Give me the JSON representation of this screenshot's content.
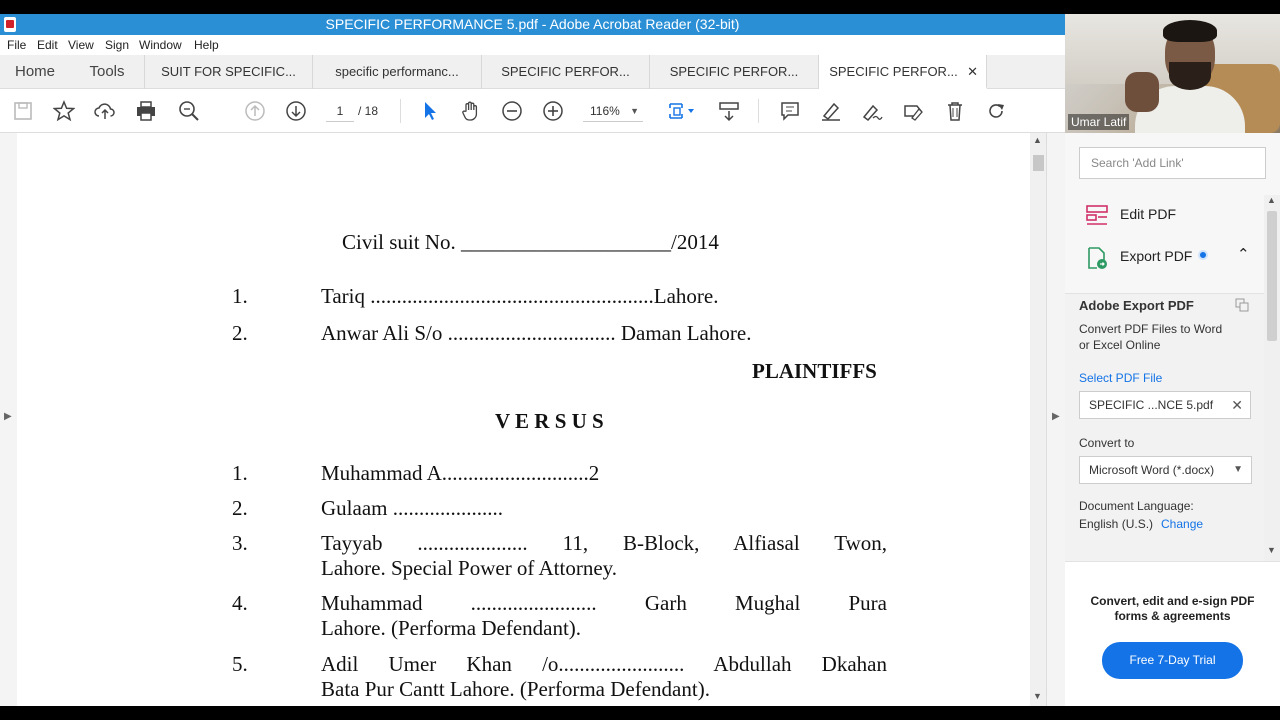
{
  "window": {
    "title": "SPECIFIC PERFORMANCE 5.pdf - Adobe Acrobat Reader (32-bit)"
  },
  "menu": [
    "File",
    "Edit",
    "View",
    "Sign",
    "Window",
    "Help"
  ],
  "nav": {
    "home": "Home",
    "tools": "Tools"
  },
  "tabs": [
    {
      "label": "SUIT FOR SPECIFIC..."
    },
    {
      "label": "specific performanc..."
    },
    {
      "label": "SPECIFIC PERFOR..."
    },
    {
      "label": "SPECIFIC PERFOR..."
    },
    {
      "label": "SPECIFIC PERFOR...",
      "active": true
    }
  ],
  "toolbar": {
    "page_current": "1",
    "page_total": "/ 18",
    "zoom": "116%",
    "icons": [
      "save-icon",
      "bookmark-star-icon",
      "upload-cloud-icon",
      "print-icon",
      "search-zoom-icon",
      "page-up-icon",
      "page-down-icon",
      "select-cursor-icon",
      "hand-icon",
      "zoom-out-icon",
      "zoom-in-icon",
      "fit-page-icon",
      "scroll-mode-icon",
      "comment-icon",
      "highlight-pen-icon",
      "sign-icon",
      "fill-sign-icon",
      "delete-icon",
      "rotate-icon"
    ]
  },
  "document": {
    "suit_line": "Civil suit No. ____________________/2014",
    "plaintiffs": [
      {
        "num": "1.",
        "text": "Tariq ......................................................Lahore."
      },
      {
        "num": "2.",
        "text": "Anwar Ali S/o ................................ Daman Lahore."
      }
    ],
    "plaintiffs_label": "PLAINTIFFS",
    "versus": "V E R S U S",
    "defendants": [
      {
        "num": "1.",
        "line1": "Muhammad A............................2",
        "line2": ""
      },
      {
        "num": "2.",
        "line1": "Gulaam .....................",
        "line2": ""
      },
      {
        "num": "3.",
        "line1": "Tayyab ..................... 11, B-Block, Alfiasal Twon,",
        "line2": "Lahore. Special Power of Attorney."
      },
      {
        "num": "4.",
        "line1": "Muhammad ........................ Garh Mughal Pura",
        "line2": "Lahore. (Performa Defendant)."
      },
      {
        "num": "5.",
        "line1": "Adil Umer Khan /o........................ Abdullah Dkahan",
        "line2": "Bata Pur Cantt Lahore. (Performa Defendant)."
      }
    ]
  },
  "webcam": {
    "name": "Umar Latif"
  },
  "right_panel": {
    "search_placeholder": "Search 'Add Link'",
    "edit_pdf": "Edit PDF",
    "export_pdf": "Export PDF",
    "adobe_export_title": "Adobe Export PDF",
    "adobe_export_desc1": "Convert PDF Files to Word",
    "adobe_export_desc2": "or Excel Online",
    "select_file_label": "Select PDF File",
    "selected_file": "SPECIFIC ...NCE 5.pdf",
    "convert_to_label": "Convert to",
    "convert_to_value": "Microsoft Word (*.docx)",
    "doc_language_label": "Document Language:",
    "doc_language_value": "English (U.S.)",
    "change_link": "Change",
    "promo_line1": "Convert, edit and e-sign PDF",
    "promo_line2": "forms & agreements",
    "trial_button": "Free 7-Day Trial"
  },
  "colors": {
    "titlebar": "#2b8fd6",
    "accent": "#1473e6",
    "link": "#1473e6"
  }
}
